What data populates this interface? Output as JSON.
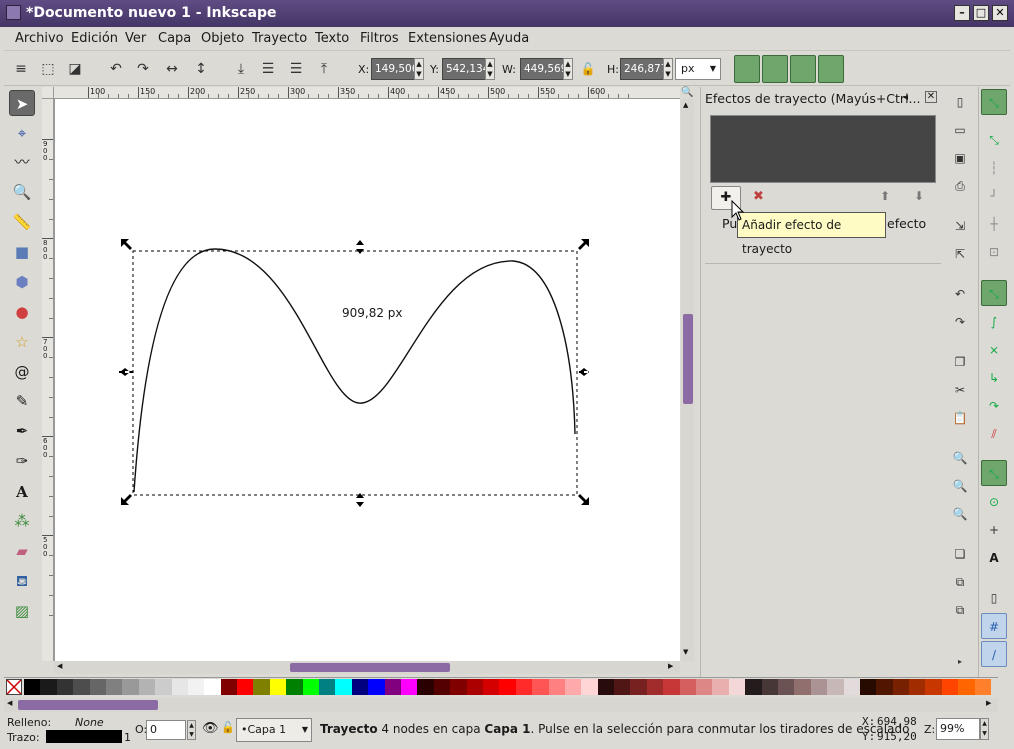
{
  "window": {
    "title": "*Documento nuevo 1 - Inkscape",
    "controls": [
      "minimize-icon",
      "maximize-icon",
      "close-icon"
    ]
  },
  "menu": [
    "Archivo",
    "Edición",
    "Ver",
    "Capa",
    "Objeto",
    "Trayecto",
    "Texto",
    "Filtros",
    "Extensiones",
    "Ayuda"
  ],
  "toolbar": {
    "x_label": "X:",
    "x_value": "149,506",
    "y_label": "Y:",
    "y_value": "542,134",
    "w_label": "W:",
    "w_value": "449,569",
    "h_label": "H:",
    "h_value": "246,877",
    "unit": "px"
  },
  "ruler": {
    "h_ticks": [
      "100",
      "150",
      "200",
      "250",
      "300",
      "350",
      "400",
      "450",
      "500",
      "550",
      "600"
    ],
    "v_ticks": [
      "900",
      "800",
      "700",
      "600",
      "500"
    ]
  },
  "canvas": {
    "measure_label": "909,82 px"
  },
  "panel": {
    "title": "Efectos de trayecto (Mayús+Ctrl...",
    "hint_left": "Pul",
    "hint_right": "efecto",
    "tooltip": "Añadir efecto de trayecto"
  },
  "status": {
    "fill_label": "Relleno:",
    "fill_value": "None",
    "stroke_label": "Trazo:",
    "stroke_width": "1",
    "opacity_label": "O:",
    "opacity_value": "0",
    "layer": "•Capa 1",
    "message_bold": "Trayecto",
    "message_mid": " 4 nodes en capa ",
    "message_layer": "Capa 1",
    "message_end": ". Pulse en la selección para conmutar los tiradores de escalado",
    "cursor_x_label": "X:",
    "cursor_x": "694,98",
    "cursor_y_label": "Y:",
    "cursor_y": "915,20",
    "zoom_label": "Z:",
    "zoom": "99%"
  },
  "palette_colors": [
    "#000000",
    "#1a1a1a",
    "#333333",
    "#4d4d4d",
    "#666666",
    "#808080",
    "#999999",
    "#b3b3b3",
    "#cccccc",
    "#e6e6e6",
    "#f2f2f2",
    "#ffffff",
    "#800000",
    "#ff0000",
    "#808000",
    "#ffff00",
    "#008000",
    "#00ff00",
    "#008080",
    "#00ffff",
    "#000080",
    "#0000ff",
    "#800080",
    "#ff00ff",
    "#2b0000",
    "#550000",
    "#800000",
    "#aa0000",
    "#d40000",
    "#ff0000",
    "#ff2a2a",
    "#ff5555",
    "#ff8080",
    "#ffaaaa",
    "#ffd5d5",
    "#280b0b",
    "#501616",
    "#782121",
    "#a02c2c",
    "#c83737",
    "#d35f5f",
    "#de8787",
    "#e9afaf",
    "#f4d7d7",
    "#241c1c",
    "#483737",
    "#6c5353",
    "#916f6f",
    "#ac9393",
    "#c8b7b7",
    "#e3dbdb",
    "#280b00",
    "#501600",
    "#782100",
    "#a02c00",
    "#c83700",
    "#ff4400",
    "#ff6600",
    "#ff7f2a"
  ]
}
